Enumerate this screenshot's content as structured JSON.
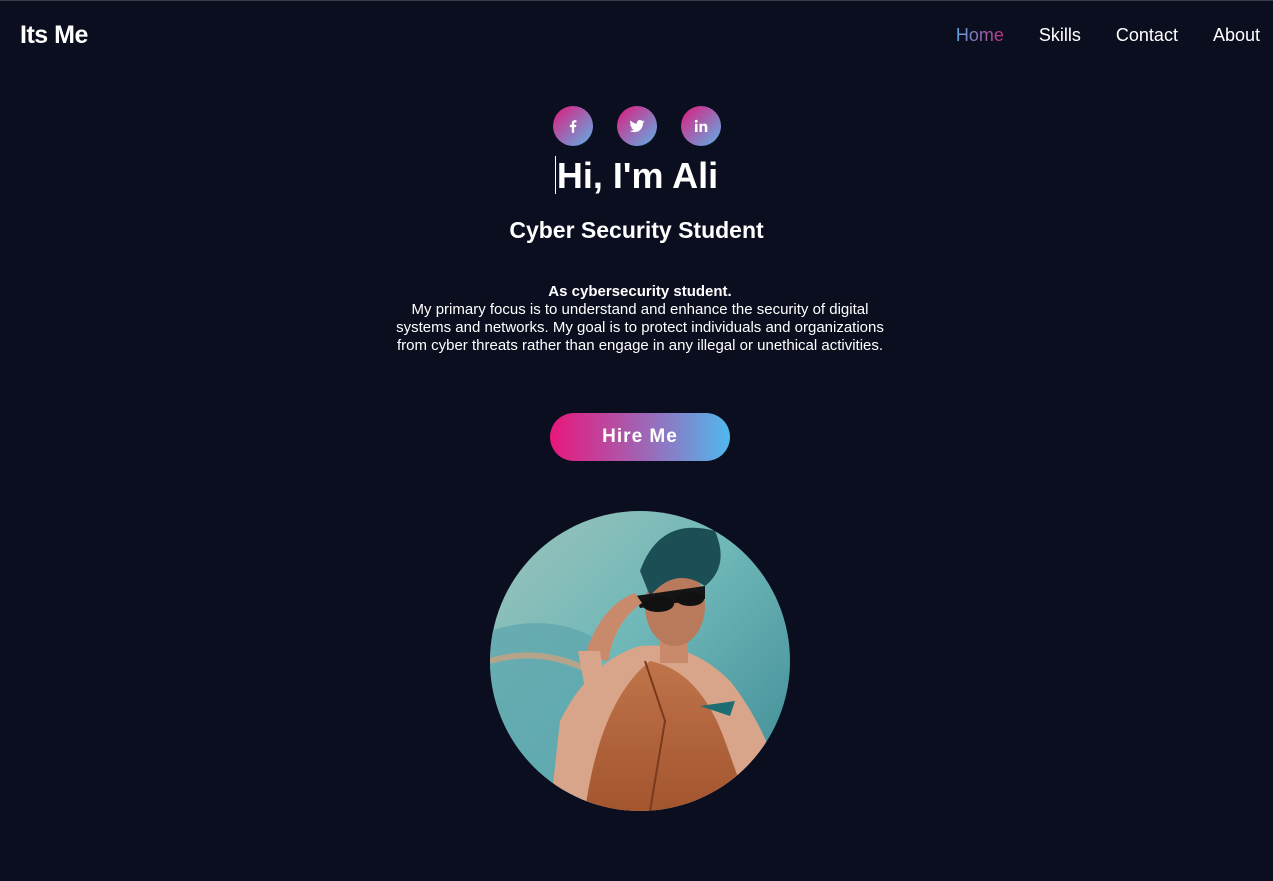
{
  "nav": {
    "brand": "Its Me",
    "links": [
      {
        "label": "Home",
        "active": true
      },
      {
        "label": "Skills"
      },
      {
        "label": "Contact"
      },
      {
        "label": "About"
      }
    ]
  },
  "socials": [
    {
      "icon": "facebook-icon"
    },
    {
      "icon": "twitter-icon"
    },
    {
      "icon": "linkedin-icon"
    }
  ],
  "hero": {
    "greeting": "Hi, I'm Ali",
    "role": "Cyber Security Student",
    "desc_lead": "As cybersecurity student.",
    "desc_body": "My primary focus is to understand and enhance the security of digital systems and networks. My goal is to protect individuals and organizations from cyber threats rather than engage in any illegal or unethical activities.",
    "cta_label": "Hire Me"
  },
  "colors": {
    "background": "#0b0e1f",
    "gradient_pink": "#e8177a",
    "gradient_blue": "#4fb8ee",
    "text": "#ffffff"
  }
}
